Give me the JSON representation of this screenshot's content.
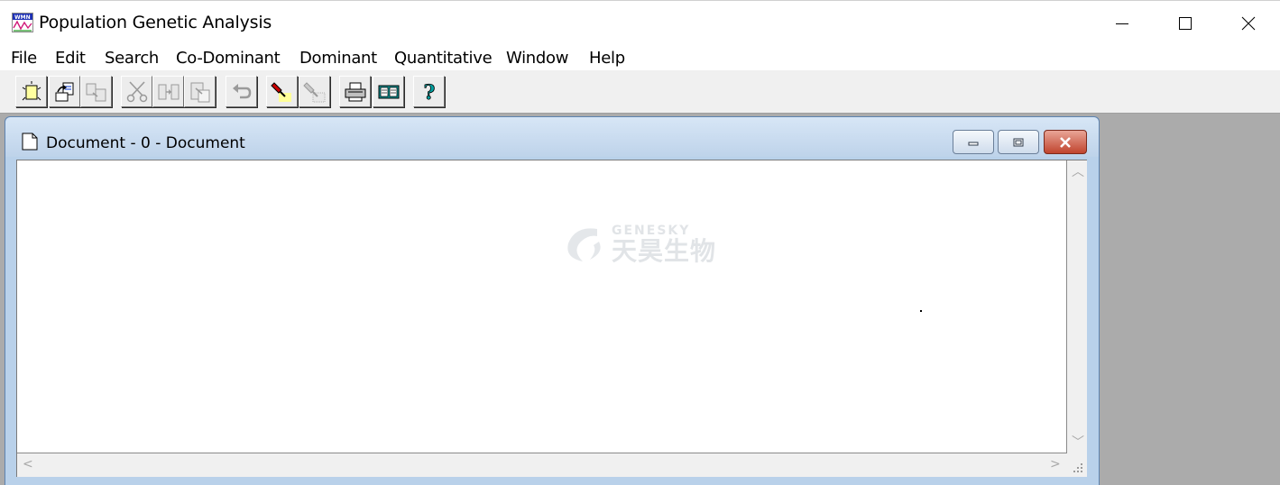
{
  "app": {
    "title": "Population Genetic Analysis"
  },
  "menu": {
    "items": [
      "File",
      "Edit",
      "Search",
      "Co-Dominant",
      "Dominant",
      "Quantitative",
      "Window",
      "Help"
    ]
  },
  "toolbar": {
    "buttons": [
      {
        "icon": "new-document-icon"
      },
      {
        "icon": "open-file-icon"
      },
      {
        "icon": "save-icon"
      },
      {
        "icon": "cut-icon"
      },
      {
        "icon": "copy-icon"
      },
      {
        "icon": "paste-icon"
      },
      {
        "icon": "undo-icon"
      },
      {
        "icon": "highlight-icon"
      },
      {
        "icon": "eraser-icon"
      },
      {
        "icon": "print-icon"
      },
      {
        "icon": "book-icon"
      },
      {
        "icon": "help-icon"
      }
    ]
  },
  "document": {
    "title": "Document - 0 - Document"
  },
  "watermark": {
    "brand": "GENESKY",
    "cn": "天昊生物"
  },
  "colors": {
    "mdi_background": "#ababab",
    "doc_frame": "#b9d1ea",
    "close_button": "#c0442e"
  }
}
